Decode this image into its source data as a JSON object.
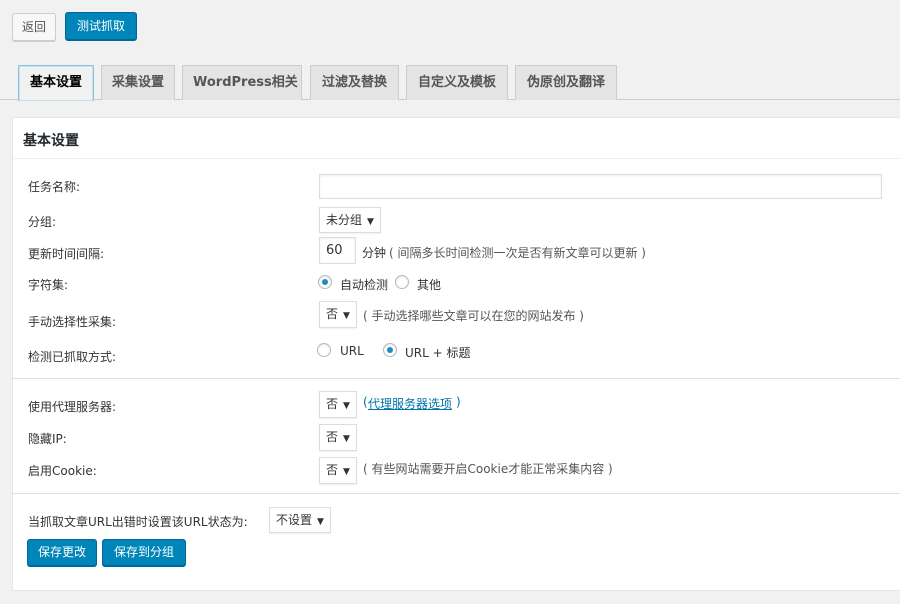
{
  "toolbar": {
    "back_label": "返回",
    "test_label": "测试抓取"
  },
  "tabs": [
    {
      "label": "基本设置",
      "active": true
    },
    {
      "label": "采集设置"
    },
    {
      "label": "WordPress相关"
    },
    {
      "label": "过滤及替换"
    },
    {
      "label": "自定义及模板"
    },
    {
      "label": "伪原创及翻译"
    }
  ],
  "panel": {
    "title": "基本设置"
  },
  "form": {
    "task_name": {
      "label": "任务名称:",
      "value": ""
    },
    "group": {
      "label": "分组:",
      "value": "未分组"
    },
    "interval": {
      "label": "更新时间间隔:",
      "value": "60",
      "unit": "分钟",
      "hint": "( 间隔多长时间检测一次是否有新文章可以更新 )"
    },
    "charset": {
      "label": "字符集:",
      "option_auto": "自动检测",
      "option_other": "其他",
      "selected": "自动检测"
    },
    "manual_select": {
      "label": "手动选择性采集:",
      "value": "否",
      "hint": "( 手动选择哪些文章可以在您的网站发布 )"
    },
    "detect_method": {
      "label": "检测已抓取方式:",
      "option_url": "URL",
      "option_url_title": "URL + 标题",
      "selected": "URL + 标题"
    },
    "proxy": {
      "label": "使用代理服务器:",
      "value": "否",
      "link": "代理服务器选项",
      "link_open": "(",
      "link_close": ")"
    },
    "hide_ip": {
      "label": "隐藏IP:",
      "value": "否"
    },
    "cookie": {
      "label": "启用Cookie:",
      "value": "否",
      "hint": "( 有些网站需要开启Cookie才能正常采集内容 )"
    },
    "error_status": {
      "label": "当抓取文章URL出错时设置该URL状态为:",
      "value": "不设置"
    }
  },
  "actions": {
    "save_label": "保存更改",
    "save_group_label": "保存到分组"
  },
  "colors": {
    "primary": "#0085ba",
    "link": "#0073aa",
    "radio_checked": "#1e8cbe"
  }
}
